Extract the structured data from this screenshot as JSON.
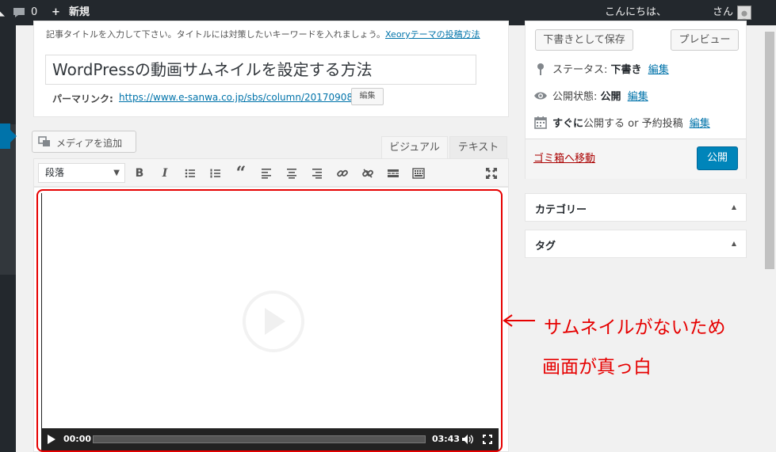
{
  "admin_bar": {
    "comment_count": "0",
    "new_label": "新規",
    "greeting": "こんにちは、",
    "user_suffix": "さん"
  },
  "title_box": {
    "hint": "記事タイトルを入力して下さい。タイトルには対策したいキーワードを入れましょう。",
    "hint_link": "Xeoryテーマの投稿方法",
    "title_value": "WordPressの動画サムネイルを設定する方法",
    "permalink_label": "パーマリンク:",
    "permalink_url": "https://www.e-sanwa.co.jp/sbs/column/20170908/",
    "permalink_edit": "編集"
  },
  "editor": {
    "media_button": "メディアを追加",
    "tabs": [
      {
        "label": "ビジュアル"
      },
      {
        "label": "テキスト"
      }
    ],
    "format_select": "段落",
    "toolbar_icons": [
      "bold-icon",
      "italic-icon",
      "bullet-list-icon",
      "numbered-list-icon",
      "blockquote-icon",
      "align-left-icon",
      "align-center-icon",
      "align-right-icon",
      "link-icon",
      "unlink-icon",
      "more-tag-icon",
      "toolbar-toggle-icon",
      "fullscreen-icon"
    ]
  },
  "video": {
    "current_time": "00:00",
    "duration": "03:43",
    "progress": 0
  },
  "annotation": {
    "line1": "サムネイルがないため",
    "line2": "画面が真っ白",
    "color": "#e60000"
  },
  "publish": {
    "save_draft": "下書きとして保存",
    "preview": "プレビュー",
    "status_label": "ステータス:",
    "status_value": "下書き",
    "status_edit": "編集",
    "visibility_label": "公開状態:",
    "visibility_value": "公開",
    "visibility_edit": "編集",
    "schedule_label": "すぐに",
    "schedule_text": "公開する or 予約投稿",
    "schedule_edit": "編集",
    "trash": "ゴミ箱へ移動",
    "publish_button": "公開"
  },
  "side_boxes": {
    "category": "カテゴリー",
    "tag": "タグ"
  },
  "colors": {
    "admin_bar": "#23282d",
    "accent": "#0073aa",
    "publish": "#0085ba",
    "annotation": "#e60000"
  }
}
